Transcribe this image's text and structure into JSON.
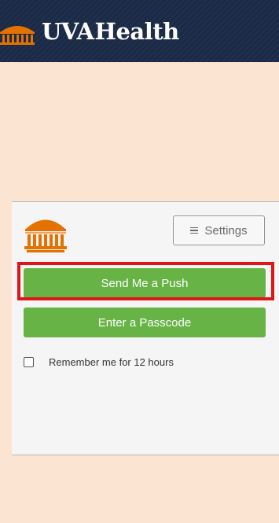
{
  "header": {
    "brand_prefix": "UVA",
    "brand_suffix": "Health",
    "icon": "rotunda-icon"
  },
  "card": {
    "logo_icon": "rotunda-logo-icon",
    "settings": {
      "label": "Settings",
      "icon": "menu-icon"
    },
    "buttons": {
      "push_label": "Send Me a Push",
      "passcode_label": "Enter a Passcode"
    },
    "remember": {
      "label": "Remember me for 12 hours",
      "checked": false
    }
  },
  "colors": {
    "header_bg": "#1b2a46",
    "page_bg": "#fce4d3",
    "card_bg": "#f5f5f5",
    "button_green": "#67b346",
    "highlight_red": "#e01515",
    "brand_orange": "#e57200"
  }
}
